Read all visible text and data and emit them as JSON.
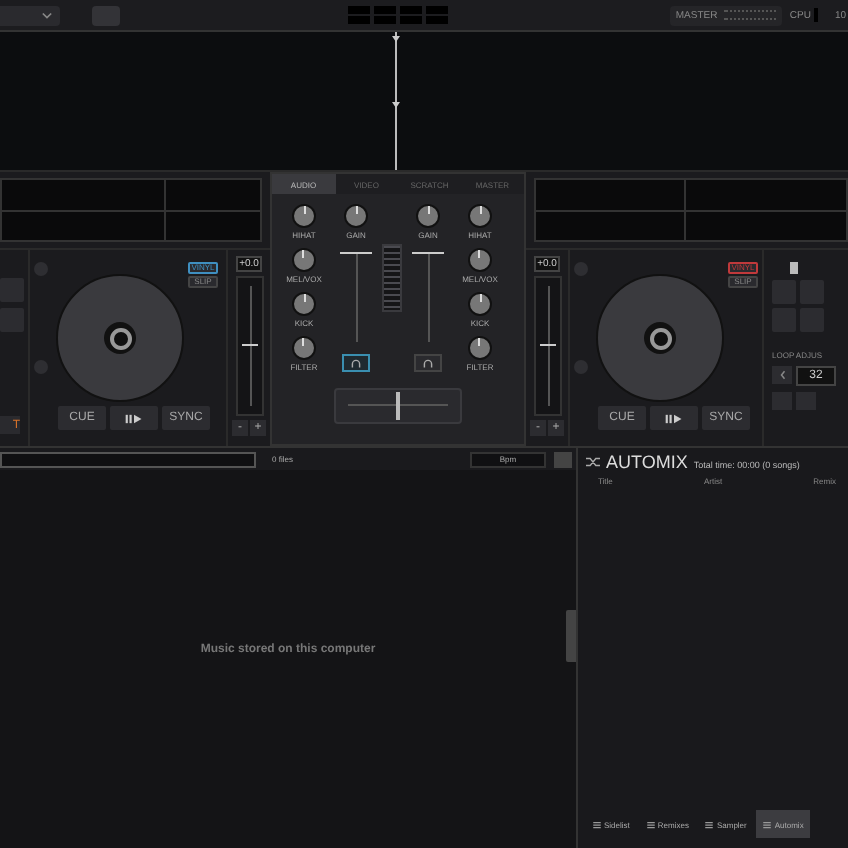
{
  "topbar": {
    "master_label": "MASTER",
    "cpu_label": "CPU",
    "edge_text": "10"
  },
  "decks": [
    {
      "pitch_reading": "+0.0",
      "pitch": {
        "level": 0.5
      },
      "vinyl": {
        "label": "VINYL",
        "on": true,
        "color": "#3f8fc0"
      },
      "slip": "SLIP",
      "cue": "CUE",
      "sync": "SYNC",
      "minus": "-",
      "plus": "+",
      "edge_button": "T"
    },
    {
      "pitch_reading": "+0.0",
      "pitch": {
        "level": 0.5
      },
      "vinyl": {
        "label": "VINYL",
        "on": true,
        "color": "#c0393b"
      },
      "slip": "SLIP",
      "cue": "CUE",
      "sync": "SYNC",
      "minus": "-",
      "plus": "+",
      "loop_title": "LOOP ADJUS",
      "loop_value": "32"
    }
  ],
  "mixer": {
    "tabs": [
      {
        "label": "AUDIO",
        "selected": true
      },
      {
        "label": "VIDEO",
        "selected": false
      },
      {
        "label": "SCRATCH",
        "selected": false
      },
      {
        "label": "MASTER",
        "selected": false
      }
    ],
    "channels": [
      {
        "gain_label": "GAIN",
        "knobs": [
          "HIHAT",
          "MEL/VOX",
          "KICK",
          "FILTER"
        ],
        "volume": {
          "level": 0.95
        },
        "headphone_on": true
      },
      {
        "gain_label": "GAIN",
        "knobs": [
          "HIHAT",
          "MEL/VOX",
          "KICK",
          "FILTER"
        ],
        "volume": {
          "level": 0.95
        },
        "headphone_on": false
      }
    ],
    "crossfader": {
      "level": 0.5
    }
  },
  "browser": {
    "file_count": "0 files",
    "sort": "Bpm",
    "empty_message": "Music stored on this computer"
  },
  "automix": {
    "title": "AUTOMIX",
    "total": "Total time: 00:00 (0 songs)",
    "columns": [
      "Title",
      "Artist",
      "Remix"
    ]
  },
  "bottom_tabs": [
    {
      "label": "Sidelist",
      "selected": false
    },
    {
      "label": "Remixes",
      "selected": false
    },
    {
      "label": "Sampler",
      "selected": false
    },
    {
      "label": "Automix",
      "selected": true
    }
  ]
}
